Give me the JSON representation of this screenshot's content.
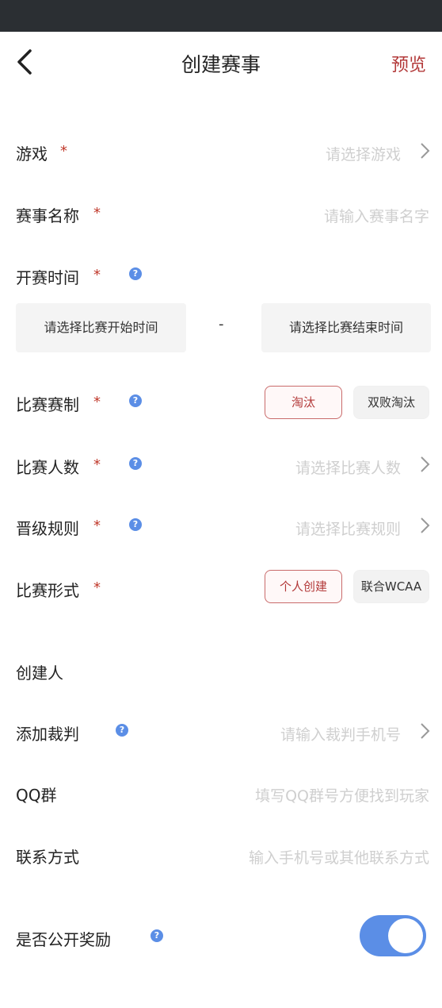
{
  "header": {
    "title": "创建赛事",
    "preview_label": "预览"
  },
  "form": {
    "star": "*",
    "help_glyph": "?",
    "game": {
      "label": "游戏",
      "placeholder": "请选择游戏"
    },
    "event_name": {
      "label": "赛事名称",
      "placeholder": "请输入赛事名字"
    },
    "start_time": {
      "label": "开赛时间",
      "start_placeholder": "请选择比赛开始时间",
      "separator": "-",
      "end_placeholder": "请选择比赛结束时间"
    },
    "format": {
      "label": "比赛赛制",
      "options": [
        "淘汰",
        "双败淘汰"
      ],
      "selected": "淘汰"
    },
    "players": {
      "label": "比赛人数",
      "placeholder": "请选择比赛人数"
    },
    "advance_rule": {
      "label": "晋级规则",
      "placeholder": "请选择比赛规则"
    },
    "mode": {
      "label": "比赛形式",
      "options": [
        "个人创建",
        "联合WCAA"
      ],
      "selected": "个人创建"
    },
    "creator": {
      "label": "创建人"
    },
    "referee": {
      "label": "添加裁判",
      "placeholder": "请输入裁判手机号"
    },
    "qq_group": {
      "label": "QQ群",
      "placeholder": "填写QQ群号方便找到玩家"
    },
    "contact": {
      "label": "联系方式",
      "placeholder": "输入手机号或其他联系方式"
    },
    "public_reward": {
      "label": "是否公开奖励",
      "enabled": true
    }
  },
  "colors": {
    "accent_red": "#b33a3a",
    "toggle_blue": "#5b8ee6",
    "status_bar": "#2b2f33"
  }
}
